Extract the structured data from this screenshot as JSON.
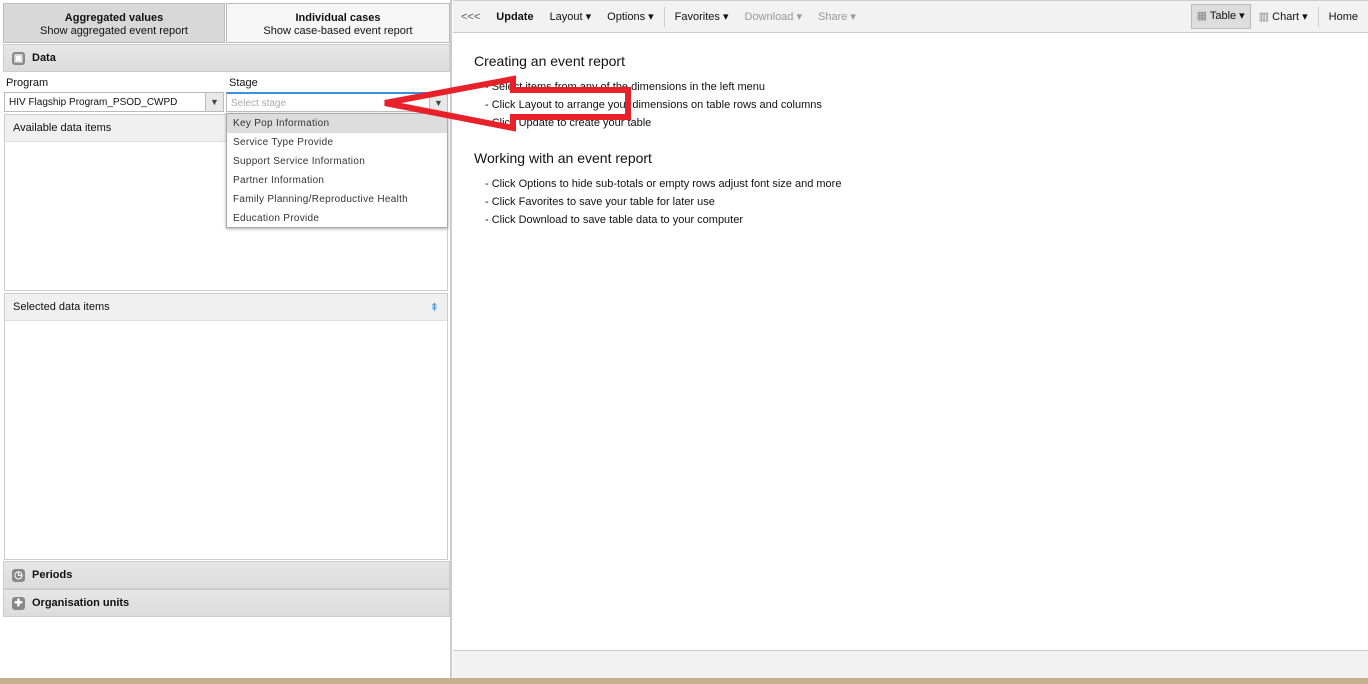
{
  "mode": {
    "aggregated_title": "Aggregated values",
    "aggregated_sub": "Show aggregated event report",
    "individual_title": "Individual cases",
    "individual_sub": "Show case-based event report"
  },
  "data_panel": {
    "title": "Data",
    "program_label": "Program",
    "program_value": "HIV Flagship Program_PSOD_CWPD",
    "stage_label": "Stage",
    "stage_placeholder": "Select stage",
    "available": "Available data items",
    "selected": "Selected data items"
  },
  "stage_options": [
    "Key Pop Information",
    "Service Type Provide",
    "Support Service Information",
    "Partner Information",
    "Family Planning/Reproductive Health",
    "Education Provide"
  ],
  "periods": "Periods",
  "org_units": "Organisation units",
  "toolbar": {
    "collapse": "<<<",
    "update": "Update",
    "layout": "Layout",
    "options": "Options",
    "favorites": "Favorites",
    "download": "Download",
    "share": "Share",
    "table": "Table",
    "chart": "Chart",
    "home": "Home"
  },
  "content": {
    "h1": "Creating an event report",
    "l1": [
      "- Select items from any of the dimensions in the left menu",
      "- Click Layout to arrange your dimensions on table rows and columns",
      "- Click Update to create your table"
    ],
    "h2": "Working with an event report",
    "l2": [
      "- Click Options to hide sub-totals or empty rows adjust font size and more",
      "- Click Favorites to save your table for later use",
      "- Click Download to save table data to your computer"
    ]
  },
  "annotation_color": "#e8202a"
}
